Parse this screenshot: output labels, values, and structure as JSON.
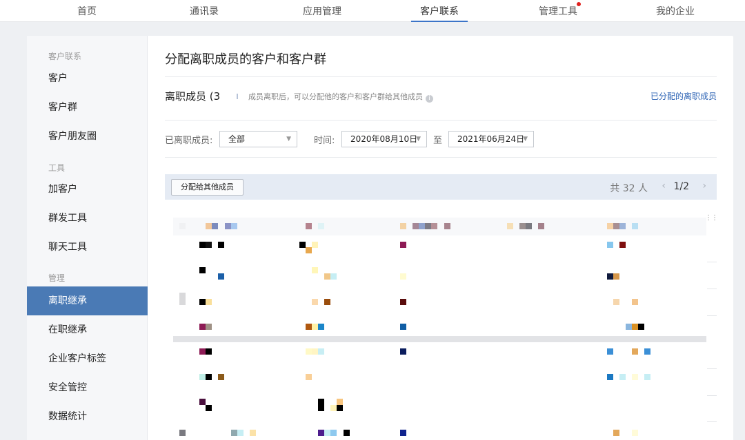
{
  "nav": {
    "tabs": [
      {
        "label": "首页"
      },
      {
        "label": "通讯录"
      },
      {
        "label": "应用管理"
      },
      {
        "label": "客户联系"
      },
      {
        "label": "管理工具"
      },
      {
        "label": "我的企业"
      }
    ],
    "active_index": 3
  },
  "sidebar": {
    "groups": [
      {
        "title": "客户联系",
        "items": [
          "客户",
          "客户群",
          "客户朋友圈"
        ]
      },
      {
        "title": "工具",
        "items": [
          "加客户",
          "群发工具",
          "聊天工具"
        ]
      },
      {
        "title": "管理",
        "items": [
          "离职继承",
          "在职继承",
          "企业客户标签",
          "安全管控",
          "数据统计"
        ]
      }
    ],
    "active_item": "离职继承"
  },
  "main": {
    "title": "分配离职成员的客户和客户群",
    "resigned_label": "离职成员 (3",
    "hint": "成员离职后，可以分配他的客户和客户群给其他成员",
    "assigned_link": "已分配的离职成员",
    "filter": {
      "member_label": "已离职成员:",
      "member_value": "全部",
      "time_label": "时间:",
      "date_from": "2020年08月10日",
      "to_label": "至",
      "date_to": "2021年06月24日"
    },
    "toolbar": {
      "assign_button": "分配给其他成员",
      "total": "共 32 人",
      "page": "1/2"
    }
  },
  "colors": {
    "accent": "#4a7ab5",
    "link": "#2e64b5",
    "toolbar_bg": "#e5ebf4",
    "badge_dot": "#e0211e"
  },
  "icons": {
    "info": "info-circle-icon",
    "caret": "caret-down-icon",
    "prev": "chevron-left-icon",
    "next": "chevron-right-icon",
    "drag": "drag-handle-icon"
  }
}
